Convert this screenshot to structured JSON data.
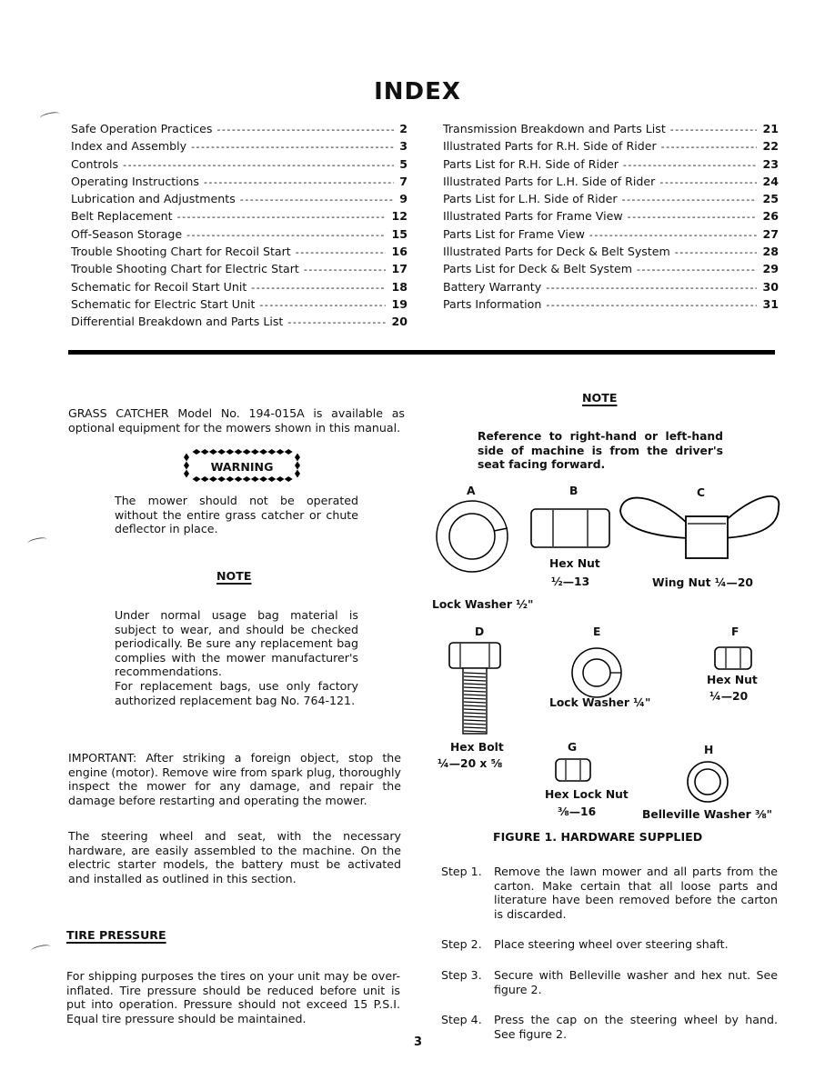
{
  "page": {
    "title": "INDEX",
    "page_number": "3"
  },
  "toc": {
    "left": [
      {
        "label": "Safe Operation Practices",
        "page": "2"
      },
      {
        "label": "Index and Assembly",
        "page": "3"
      },
      {
        "label": "Controls",
        "page": "5"
      },
      {
        "label": "Operating Instructions",
        "page": "7"
      },
      {
        "label": "Lubrication and Adjustments",
        "page": "9"
      },
      {
        "label": "Belt Replacement",
        "page": "12"
      },
      {
        "label": "Off-Season Storage",
        "page": "15"
      },
      {
        "label": "Trouble Shooting Chart for Recoil Start",
        "page": "16"
      },
      {
        "label": "Trouble Shooting Chart for Electric Start",
        "page": "17"
      },
      {
        "label": "Schematic for Recoil Start Unit",
        "page": "18"
      },
      {
        "label": "Schematic for Electric Start Unit",
        "page": "19"
      },
      {
        "label": "Differential Breakdown and Parts List",
        "page": "20"
      }
    ],
    "right": [
      {
        "label": "Transmission Breakdown and Parts List",
        "page": "21"
      },
      {
        "label": "Illustrated Parts for R.H. Side of Rider",
        "page": "22"
      },
      {
        "label": "Parts List for R.H. Side of Rider",
        "page": "23"
      },
      {
        "label": "Illustrated Parts for L.H. Side of Rider",
        "page": "24"
      },
      {
        "label": "Parts List for L.H. Side of Rider",
        "page": "25"
      },
      {
        "label": "Illustrated Parts for Frame View",
        "page": "26"
      },
      {
        "label": "Parts List for Frame View",
        "page": "27"
      },
      {
        "label": "Illustrated Parts for Deck & Belt System",
        "page": "28"
      },
      {
        "label": "Parts List for Deck & Belt System",
        "page": "29"
      },
      {
        "label": "Battery Warranty",
        "page": "30"
      },
      {
        "label": "Parts Information",
        "page": "31"
      }
    ]
  },
  "left_column": {
    "grass_catcher": "GRASS CATCHER Model No. 194-015A is available as optional equipment for the mowers shown in this manual.",
    "warning": {
      "title": "WARNING",
      "text": "The mower should not be operated without the entire grass catcher or chute deflector in place."
    },
    "note": {
      "title": "NOTE",
      "text1": "Under normal usage bag material is subject to wear, and should be checked periodically. Be sure any replacement bag complies with the mower manufacturer's recommendations.",
      "text2": "For replacement bags, use only factory authorized replacement bag No. 764-121."
    },
    "important": "IMPORTANT: After striking a foreign object, stop the engine (motor). Remove wire from spark plug, thoroughly inspect the mower for any damage, and repair the damage before restarting and operating the mower.",
    "assembly_intro": "The steering wheel and seat, with the necessary hardware, are easily assembled to the machine. On the electric starter models, the battery must be activated and installed as outlined in this section.",
    "tire_pressure": {
      "title": "TIRE PRESSURE",
      "text": "For shipping purposes the tires on your unit may be over-inflated. Tire pressure should be reduced before unit is put into operation. Pressure should not exceed 15 P.S.I. Equal tire pressure should be maintained."
    }
  },
  "right_column": {
    "note": {
      "title": "NOTE",
      "text": "Reference to right-hand or left-hand side of machine is from the driver's seat facing forward."
    },
    "figure": {
      "caption": "FIGURE 1. HARDWARE SUPPLIED",
      "parts": [
        {
          "letter": "A",
          "name": "Lock Washer ½\"",
          "size": ""
        },
        {
          "letter": "B",
          "name": "Hex Nut",
          "size": "½—13"
        },
        {
          "letter": "C",
          "name": "Wing Nut ¼—20",
          "size": ""
        },
        {
          "letter": "D",
          "name": "Hex Bolt",
          "size": "¼—20 x ⅝"
        },
        {
          "letter": "E",
          "name": "Lock Washer ¼\"",
          "size": ""
        },
        {
          "letter": "F",
          "name": "Hex Nut",
          "size": "¼—20"
        },
        {
          "letter": "G",
          "name": "Hex Lock Nut",
          "size": "⅜—16"
        },
        {
          "letter": "H",
          "name": "Belleville Washer ⅜\"",
          "size": ""
        }
      ]
    },
    "steps": [
      {
        "label": "Step 1.",
        "text": "Remove the lawn mower and all parts from the carton. Make certain that all loose parts and literature have been removed before the carton is discarded."
      },
      {
        "label": "Step 2.",
        "text": "Place steering wheel over steering shaft."
      },
      {
        "label": "Step 3.",
        "text": "Secure with Belleville washer and hex nut. See figure 2."
      },
      {
        "label": "Step 4.",
        "text": "Press the cap on the steering wheel by hand. See figure 2."
      }
    ]
  }
}
